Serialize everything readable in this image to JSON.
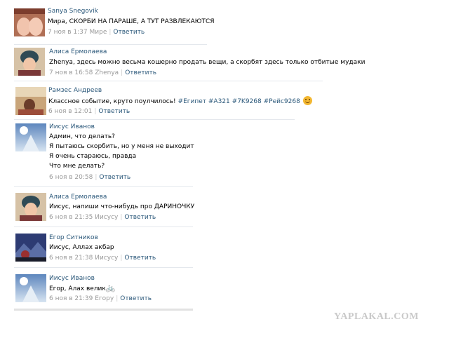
{
  "comments": [
    {
      "author": "Sanya Snegovik",
      "text": "Мира, СКОРБИ НА ПАРАШЕ, А ТУТ РАЗВЛЕКАЮТСЯ",
      "date": "7 ноя в 1:37 Мире",
      "reply": "Ответить",
      "avatar": "avatar-sanya"
    },
    {
      "author": "Алиса Ермолаева",
      "text": "Zhenya, здесь можно весьма кошерно продать вещи, а скорбят здесь только отбитые мудаки",
      "date": "7 ноя в 16:58 Zhenya",
      "reply": "Ответить",
      "avatar": "avatar-alisa"
    },
    {
      "author": "Рамзес Андреев",
      "text_plain": "Классное событие, круто поулчилось!",
      "tags": [
        "#Египет",
        "#A321",
        "#7K9268",
        "#Рейс9268"
      ],
      "emoji": "smile-icon",
      "date": "6 ноя в 12:01",
      "reply": "Ответить",
      "avatar": "avatar-ramzes"
    },
    {
      "author": "Иисус Иванов",
      "lines": [
        "Админ, что делать?",
        "Я пытаюсь скорбить, но у меня не выходит",
        "Я очень стараюсь, правда",
        "Что мне делать?"
      ],
      "date": "6 ноя в 20:58",
      "reply": "Ответить",
      "avatar": "avatar-iisus"
    },
    {
      "author": "Алиса Ермолаева",
      "text": "Иисус, напиши что-нибудь про ДАРИНОЧКУ",
      "date": "6 ноя в 21:35 Иисусу",
      "reply": "Ответить",
      "avatar": "avatar-alisa"
    },
    {
      "author": "Егор Ситников",
      "text": "Иисус, Аллах акбар",
      "date": "6 ноя в 21:38 Иисусу",
      "reply": "Ответить",
      "avatar": "avatar-egor"
    },
    {
      "author": "Иисус Иванов",
      "text": "Егор, Алах велик",
      "emoji": "bicycle-icon",
      "date": "6 ноя в 21:39 Егору",
      "reply": "Ответить",
      "avatar": "avatar-iisus"
    }
  ],
  "watermark": "YAPLAKAL.COM",
  "colors": {
    "link": "#2b587a",
    "meta": "#999999",
    "divider": "#e4e8ed"
  }
}
